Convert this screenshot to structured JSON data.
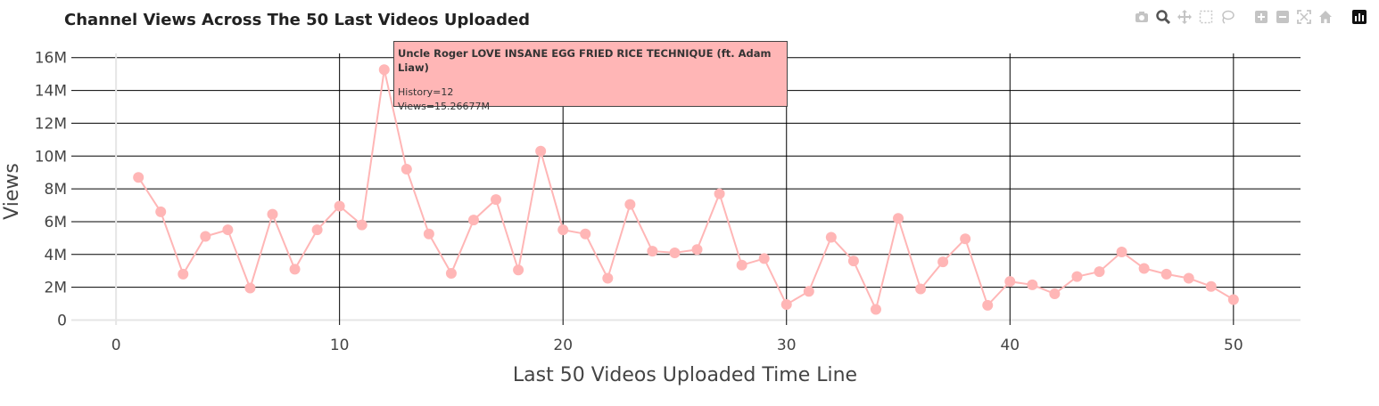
{
  "title": "Channel Views Across The 50 Last Videos Uploaded",
  "modebar": {
    "icons": [
      "camera-icon",
      "zoom-icon",
      "pan-icon",
      "box-select-icon",
      "lasso-icon",
      "zoom-in-icon",
      "zoom-out-icon",
      "autoscale-icon",
      "home-icon",
      "plotly-logo-icon"
    ]
  },
  "tooltip": {
    "title": "Uncle Roger LOVE INSANE EGG FRIED RICE TECHNIQUE (ft. Adam Liaw)",
    "line1": "History=12",
    "line2": "Views=15.26677M"
  },
  "chart_data": {
    "type": "line",
    "title": "Channel Views Across The 50 Last Videos Uploaded",
    "xlabel": "Last 50 Videos Uploaded Time Line",
    "ylabel": "Views",
    "xlim": [
      -2,
      53
    ],
    "ylim": [
      -300000,
      16800000
    ],
    "xticks": [
      0,
      10,
      20,
      30,
      40,
      50
    ],
    "xtick_labels": [
      "0",
      "10",
      "20",
      "30",
      "40",
      "50"
    ],
    "yticks": [
      0,
      2000000,
      4000000,
      6000000,
      8000000,
      10000000,
      12000000,
      14000000,
      16000000
    ],
    "ytick_labels": [
      "0",
      "2M",
      "4M",
      "6M",
      "8M",
      "10M",
      "12M",
      "14M",
      "16M"
    ],
    "grid": true,
    "line_color": "#ffb6b6",
    "grid_color": "#000000",
    "series": [
      {
        "x": [
          1,
          2,
          3,
          4,
          5,
          6,
          7,
          8,
          9,
          10,
          11,
          12,
          13,
          14,
          15,
          16,
          17,
          18,
          19,
          20,
          21,
          22,
          23,
          24,
          25,
          26,
          27,
          28,
          29,
          30,
          31,
          32,
          33,
          34,
          35,
          36,
          37,
          38,
          39,
          40,
          41,
          42,
          43,
          44,
          45,
          46,
          47,
          48,
          49,
          50
        ],
        "y": [
          8700000,
          6600000,
          2800000,
          5100000,
          5500000,
          1950000,
          6450000,
          3100000,
          5500000,
          6950000,
          5800000,
          15266770,
          9200000,
          5250000,
          2850000,
          6100000,
          7350000,
          3050000,
          10300000,
          5500000,
          5250000,
          2550000,
          7050000,
          4200000,
          4100000,
          4300000,
          7700000,
          3350000,
          3750000,
          950000,
          1750000,
          5050000,
          3600000,
          650000,
          6200000,
          1900000,
          3550000,
          4950000,
          900000,
          2350000,
          2150000,
          1600000,
          2650000,
          2950000,
          4150000,
          3150000,
          2800000,
          2550000,
          2050000,
          1250000
        ]
      }
    ]
  }
}
